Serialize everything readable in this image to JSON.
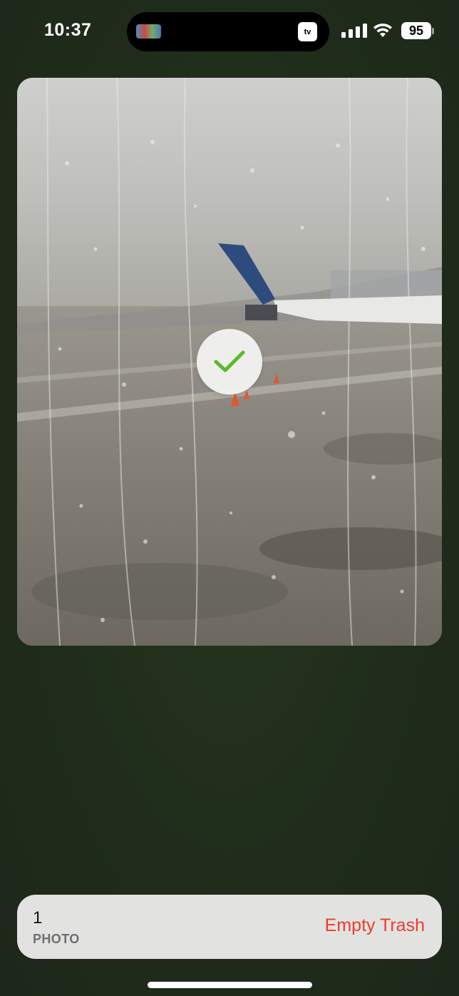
{
  "status_bar": {
    "time": "10:37",
    "battery": "95",
    "island_app_icon": "tv",
    "icons": [
      "cellular-signal-icon",
      "wifi-icon",
      "battery-icon"
    ]
  },
  "photo": {
    "selected": true,
    "check_color": "#5bb82e"
  },
  "bottom_bar": {
    "count": "1",
    "count_label": "PHOTO",
    "action_label": "Empty Trash",
    "action_color": "#ec3b2f"
  }
}
